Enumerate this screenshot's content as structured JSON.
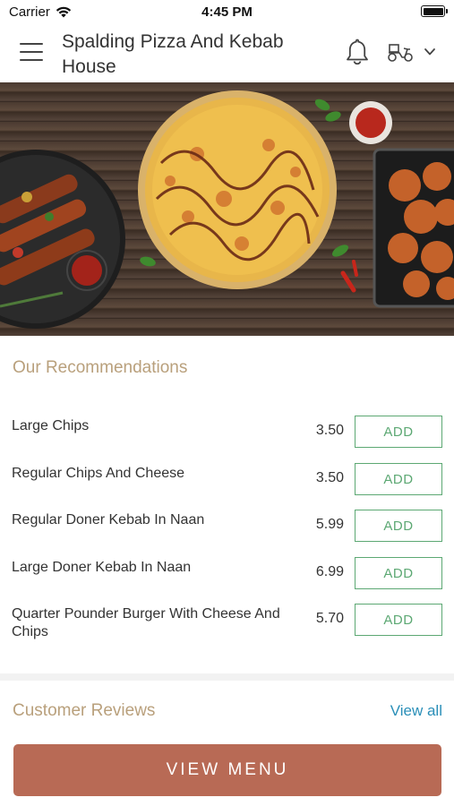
{
  "status_bar": {
    "carrier": "Carrier",
    "time": "4:45 PM"
  },
  "header": {
    "title": "Spalding Pizza And Kebab House",
    "icons": [
      "menu-icon",
      "bell-icon",
      "delivery-scooter-icon",
      "chevron-down-icon"
    ]
  },
  "hero": {
    "description_icon": "food-banner-image"
  },
  "recommendations": {
    "title": "Our Recommendations",
    "add_label": "ADD",
    "items": [
      {
        "name": "Large Chips",
        "price": "3.50"
      },
      {
        "name": "Regular Chips And Cheese",
        "price": "3.50"
      },
      {
        "name": "Regular Doner Kebab In Naan",
        "price": "5.99"
      },
      {
        "name": "Large Doner Kebab In Naan",
        "price": "6.99"
      },
      {
        "name": "Quarter Pounder Burger With Cheese And Chips",
        "price": "5.70"
      }
    ]
  },
  "reviews": {
    "title": "Customer Reviews",
    "view_all": "View all"
  },
  "footer": {
    "cta": "VIEW MENU"
  },
  "colors": {
    "accent_gold": "#b9a07c",
    "add_green": "#5ca873",
    "link_blue": "#2a8fb8",
    "cta_bg": "#b86a55"
  }
}
